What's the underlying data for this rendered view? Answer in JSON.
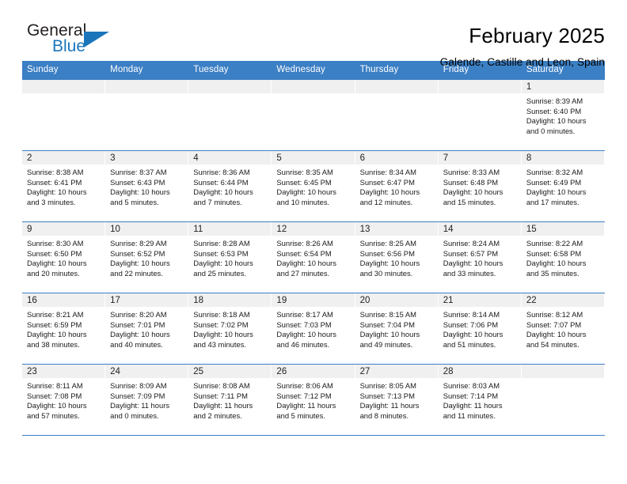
{
  "brand": {
    "name_part1": "General",
    "name_part2": "Blue",
    "logo_icon": "triangle-logo-icon"
  },
  "header": {
    "title": "February 2025",
    "location": "Galende, Castille and Leon, Spain"
  },
  "colors": {
    "header_blue": "#3b7fc4",
    "brand_blue": "#1b75bb",
    "daynum_band": "#f0f0f0"
  },
  "weekdays": [
    "Sunday",
    "Monday",
    "Tuesday",
    "Wednesday",
    "Thursday",
    "Friday",
    "Saturday"
  ],
  "weeks": [
    [
      {
        "day": "",
        "sunrise": "",
        "sunset": "",
        "daylight1": "",
        "daylight2": ""
      },
      {
        "day": "",
        "sunrise": "",
        "sunset": "",
        "daylight1": "",
        "daylight2": ""
      },
      {
        "day": "",
        "sunrise": "",
        "sunset": "",
        "daylight1": "",
        "daylight2": ""
      },
      {
        "day": "",
        "sunrise": "",
        "sunset": "",
        "daylight1": "",
        "daylight2": ""
      },
      {
        "day": "",
        "sunrise": "",
        "sunset": "",
        "daylight1": "",
        "daylight2": ""
      },
      {
        "day": "",
        "sunrise": "",
        "sunset": "",
        "daylight1": "",
        "daylight2": ""
      },
      {
        "day": "1",
        "sunrise": "Sunrise: 8:39 AM",
        "sunset": "Sunset: 6:40 PM",
        "daylight1": "Daylight: 10 hours",
        "daylight2": "and 0 minutes."
      }
    ],
    [
      {
        "day": "2",
        "sunrise": "Sunrise: 8:38 AM",
        "sunset": "Sunset: 6:41 PM",
        "daylight1": "Daylight: 10 hours",
        "daylight2": "and 3 minutes."
      },
      {
        "day": "3",
        "sunrise": "Sunrise: 8:37 AM",
        "sunset": "Sunset: 6:43 PM",
        "daylight1": "Daylight: 10 hours",
        "daylight2": "and 5 minutes."
      },
      {
        "day": "4",
        "sunrise": "Sunrise: 8:36 AM",
        "sunset": "Sunset: 6:44 PM",
        "daylight1": "Daylight: 10 hours",
        "daylight2": "and 7 minutes."
      },
      {
        "day": "5",
        "sunrise": "Sunrise: 8:35 AM",
        "sunset": "Sunset: 6:45 PM",
        "daylight1": "Daylight: 10 hours",
        "daylight2": "and 10 minutes."
      },
      {
        "day": "6",
        "sunrise": "Sunrise: 8:34 AM",
        "sunset": "Sunset: 6:47 PM",
        "daylight1": "Daylight: 10 hours",
        "daylight2": "and 12 minutes."
      },
      {
        "day": "7",
        "sunrise": "Sunrise: 8:33 AM",
        "sunset": "Sunset: 6:48 PM",
        "daylight1": "Daylight: 10 hours",
        "daylight2": "and 15 minutes."
      },
      {
        "day": "8",
        "sunrise": "Sunrise: 8:32 AM",
        "sunset": "Sunset: 6:49 PM",
        "daylight1": "Daylight: 10 hours",
        "daylight2": "and 17 minutes."
      }
    ],
    [
      {
        "day": "9",
        "sunrise": "Sunrise: 8:30 AM",
        "sunset": "Sunset: 6:50 PM",
        "daylight1": "Daylight: 10 hours",
        "daylight2": "and 20 minutes."
      },
      {
        "day": "10",
        "sunrise": "Sunrise: 8:29 AM",
        "sunset": "Sunset: 6:52 PM",
        "daylight1": "Daylight: 10 hours",
        "daylight2": "and 22 minutes."
      },
      {
        "day": "11",
        "sunrise": "Sunrise: 8:28 AM",
        "sunset": "Sunset: 6:53 PM",
        "daylight1": "Daylight: 10 hours",
        "daylight2": "and 25 minutes."
      },
      {
        "day": "12",
        "sunrise": "Sunrise: 8:26 AM",
        "sunset": "Sunset: 6:54 PM",
        "daylight1": "Daylight: 10 hours",
        "daylight2": "and 27 minutes."
      },
      {
        "day": "13",
        "sunrise": "Sunrise: 8:25 AM",
        "sunset": "Sunset: 6:56 PM",
        "daylight1": "Daylight: 10 hours",
        "daylight2": "and 30 minutes."
      },
      {
        "day": "14",
        "sunrise": "Sunrise: 8:24 AM",
        "sunset": "Sunset: 6:57 PM",
        "daylight1": "Daylight: 10 hours",
        "daylight2": "and 33 minutes."
      },
      {
        "day": "15",
        "sunrise": "Sunrise: 8:22 AM",
        "sunset": "Sunset: 6:58 PM",
        "daylight1": "Daylight: 10 hours",
        "daylight2": "and 35 minutes."
      }
    ],
    [
      {
        "day": "16",
        "sunrise": "Sunrise: 8:21 AM",
        "sunset": "Sunset: 6:59 PM",
        "daylight1": "Daylight: 10 hours",
        "daylight2": "and 38 minutes."
      },
      {
        "day": "17",
        "sunrise": "Sunrise: 8:20 AM",
        "sunset": "Sunset: 7:01 PM",
        "daylight1": "Daylight: 10 hours",
        "daylight2": "and 40 minutes."
      },
      {
        "day": "18",
        "sunrise": "Sunrise: 8:18 AM",
        "sunset": "Sunset: 7:02 PM",
        "daylight1": "Daylight: 10 hours",
        "daylight2": "and 43 minutes."
      },
      {
        "day": "19",
        "sunrise": "Sunrise: 8:17 AM",
        "sunset": "Sunset: 7:03 PM",
        "daylight1": "Daylight: 10 hours",
        "daylight2": "and 46 minutes."
      },
      {
        "day": "20",
        "sunrise": "Sunrise: 8:15 AM",
        "sunset": "Sunset: 7:04 PM",
        "daylight1": "Daylight: 10 hours",
        "daylight2": "and 49 minutes."
      },
      {
        "day": "21",
        "sunrise": "Sunrise: 8:14 AM",
        "sunset": "Sunset: 7:06 PM",
        "daylight1": "Daylight: 10 hours",
        "daylight2": "and 51 minutes."
      },
      {
        "day": "22",
        "sunrise": "Sunrise: 8:12 AM",
        "sunset": "Sunset: 7:07 PM",
        "daylight1": "Daylight: 10 hours",
        "daylight2": "and 54 minutes."
      }
    ],
    [
      {
        "day": "23",
        "sunrise": "Sunrise: 8:11 AM",
        "sunset": "Sunset: 7:08 PM",
        "daylight1": "Daylight: 10 hours",
        "daylight2": "and 57 minutes."
      },
      {
        "day": "24",
        "sunrise": "Sunrise: 8:09 AM",
        "sunset": "Sunset: 7:09 PM",
        "daylight1": "Daylight: 11 hours",
        "daylight2": "and 0 minutes."
      },
      {
        "day": "25",
        "sunrise": "Sunrise: 8:08 AM",
        "sunset": "Sunset: 7:11 PM",
        "daylight1": "Daylight: 11 hours",
        "daylight2": "and 2 minutes."
      },
      {
        "day": "26",
        "sunrise": "Sunrise: 8:06 AM",
        "sunset": "Sunset: 7:12 PM",
        "daylight1": "Daylight: 11 hours",
        "daylight2": "and 5 minutes."
      },
      {
        "day": "27",
        "sunrise": "Sunrise: 8:05 AM",
        "sunset": "Sunset: 7:13 PM",
        "daylight1": "Daylight: 11 hours",
        "daylight2": "and 8 minutes."
      },
      {
        "day": "28",
        "sunrise": "Sunrise: 8:03 AM",
        "sunset": "Sunset: 7:14 PM",
        "daylight1": "Daylight: 11 hours",
        "daylight2": "and 11 minutes."
      },
      {
        "day": "",
        "sunrise": "",
        "sunset": "",
        "daylight1": "",
        "daylight2": ""
      }
    ]
  ]
}
